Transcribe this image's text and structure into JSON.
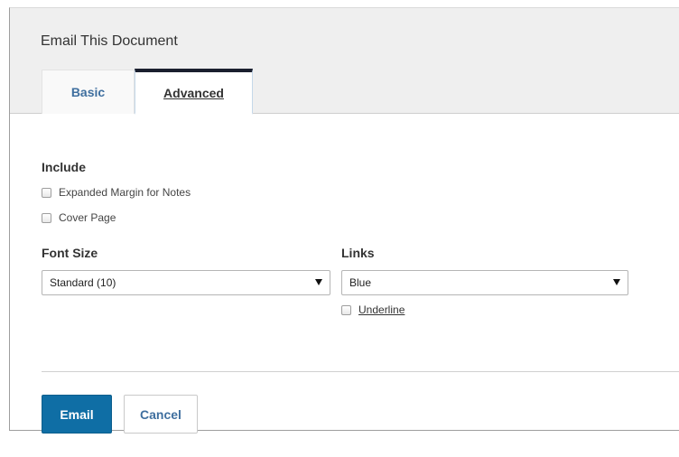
{
  "dialog": {
    "title": "Email This Document",
    "tabs": [
      {
        "label": "Basic",
        "active": false
      },
      {
        "label": "Advanced",
        "active": true
      }
    ]
  },
  "include": {
    "label": "Include",
    "options": [
      {
        "label": "Expanded Margin for Notes",
        "checked": false
      },
      {
        "label": "Cover Page",
        "checked": false
      }
    ]
  },
  "font_size": {
    "label": "Font Size",
    "selected": "Standard (10)"
  },
  "links": {
    "label": "Links",
    "selected": "Blue",
    "underline_label": "Underline",
    "underline_checked": false
  },
  "actions": {
    "email_label": "Email",
    "cancel_label": "Cancel"
  },
  "colors": {
    "primary": "#0f6ea5",
    "tab_active_bar": "#1a1f2e",
    "link_blue": "#3f6f9f"
  }
}
